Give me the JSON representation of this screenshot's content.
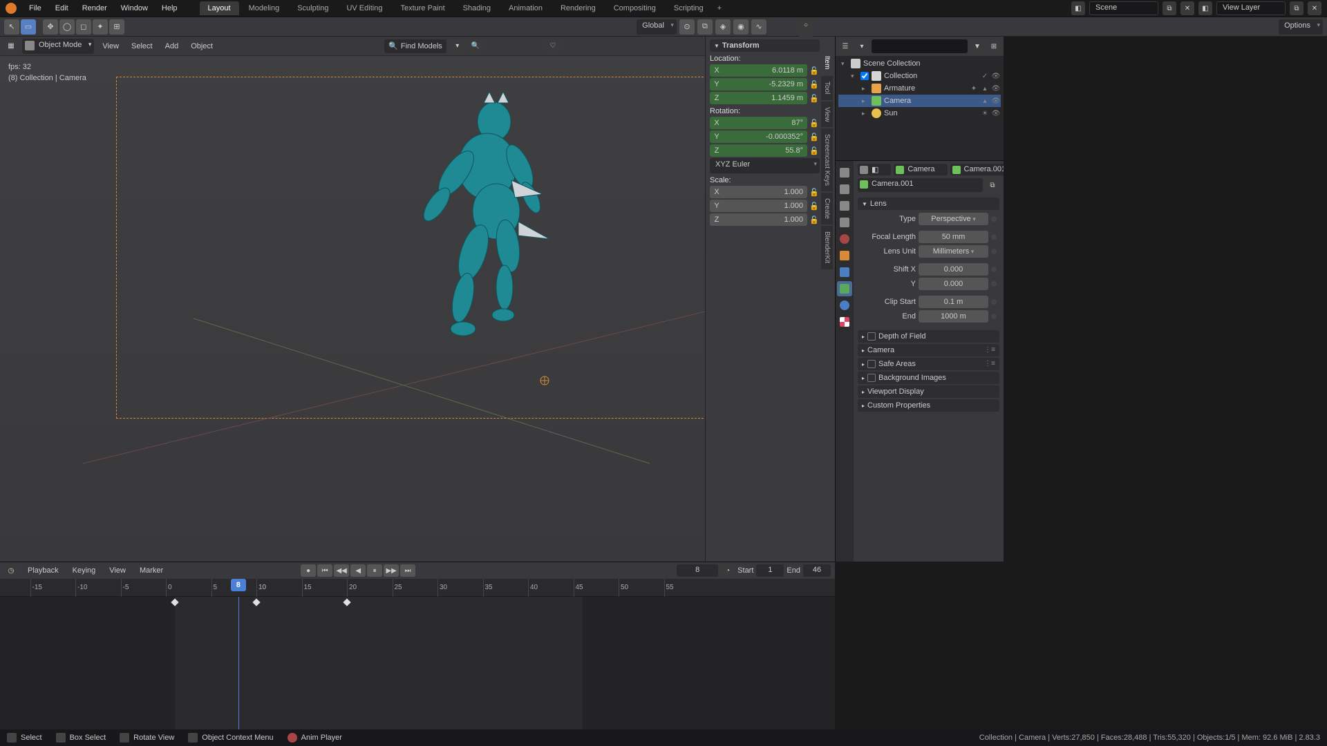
{
  "menu": {
    "file": "File",
    "edit": "Edit",
    "render": "Render",
    "window": "Window",
    "help": "Help"
  },
  "workspaces": [
    "Layout",
    "Modeling",
    "Sculpting",
    "UV Editing",
    "Texture Paint",
    "Shading",
    "Animation",
    "Rendering",
    "Compositing",
    "Scripting"
  ],
  "active_workspace": 0,
  "scene_name": "Scene",
  "viewlayer_name": "View Layer",
  "toolhdr": {
    "orientation": "Global",
    "options": "Options"
  },
  "view3d": {
    "mode": "Object Mode",
    "menus": [
      "View",
      "Select",
      "Add",
      "Object"
    ],
    "find": "Find Models",
    "info_fps": "fps: 32",
    "info_ctx": "(8) Collection | Camera"
  },
  "npanel": {
    "hdr": "Transform",
    "loc_label": "Location:",
    "loc": {
      "x": "6.0118 m",
      "y": "-5.2329 m",
      "z": "1.1459 m"
    },
    "rot_label": "Rotation:",
    "rot": {
      "x": "87°",
      "y": "-0.000352°",
      "z": "55.8°"
    },
    "rot_mode": "XYZ Euler",
    "scale_label": "Scale:",
    "scale": {
      "x": "1.000",
      "y": "1.000",
      "z": "1.000"
    },
    "tabs": [
      "Item",
      "Tool",
      "View",
      "Screencast Keys",
      "Create",
      "BlenderKit"
    ]
  },
  "outliner": {
    "root": "Scene Collection",
    "coll": "Collection",
    "items": [
      "Armature",
      "Camera",
      "Sun"
    ],
    "sel_index": 1
  },
  "props": {
    "bc1": "Camera",
    "bc2": "Camera.001",
    "bc3": "Camera.001",
    "lens": {
      "hdr": "Lens",
      "type_label": "Type",
      "type": "Perspective",
      "flen_label": "Focal Length",
      "flen": "50 mm",
      "unit_label": "Lens Unit",
      "unit": "Millimeters",
      "shiftx_label": "Shift X",
      "shiftx": "0.000",
      "shifty_label": "Y",
      "shifty": "0.000",
      "clipstart_label": "Clip Start",
      "clipstart": "0.1 m",
      "clipend_label": "End",
      "clipend": "1000 m"
    },
    "sections": [
      "Depth of Field",
      "Camera",
      "Safe Areas",
      "Background Images",
      "Viewport Display",
      "Custom Properties"
    ]
  },
  "timeline": {
    "menus": [
      "Playback",
      "Keying",
      "View",
      "Marker"
    ],
    "frame_current": "8",
    "start_label": "Start",
    "start": "1",
    "end_label": "End",
    "end": "46",
    "ticks": [
      -15,
      -10,
      -5,
      0,
      5,
      10,
      15,
      20,
      25,
      30,
      35,
      40,
      45,
      50,
      55
    ],
    "cursor": 8,
    "key_frames": [
      1,
      10,
      20
    ],
    "tick_label_8": "8"
  },
  "status": {
    "select": "Select",
    "boxselect": "Box Select",
    "rotate": "Rotate View",
    "ctxmenu": "Object Context Menu",
    "animplayer": "Anim Player",
    "stats": "Collection | Camera | Verts:27,850 | Faces:28,488 | Tris:55,320 | Objects:1/5 | Mem: 92.6 MiB | 2.83.3"
  }
}
